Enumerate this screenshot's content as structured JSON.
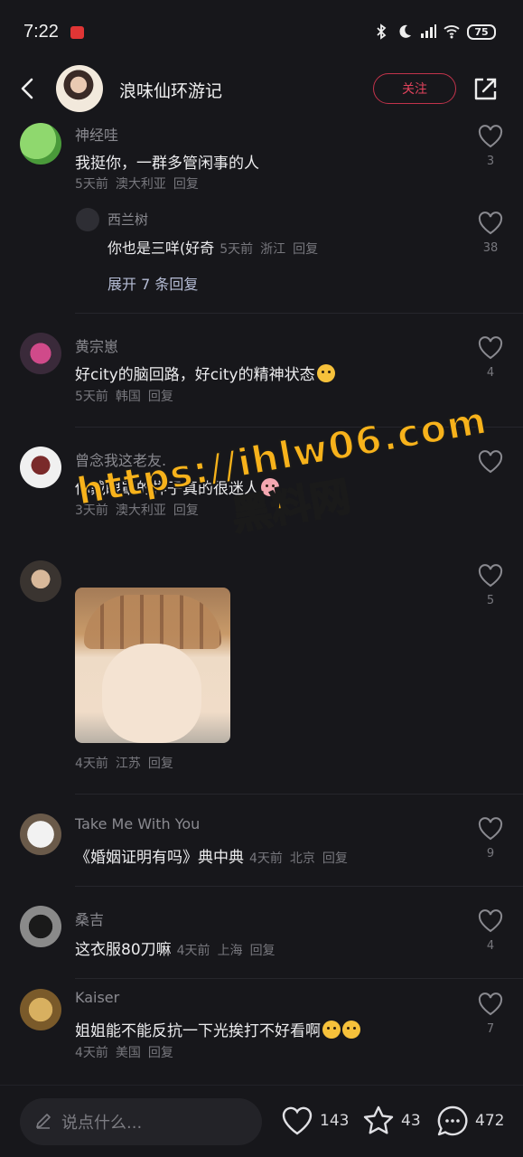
{
  "status": {
    "time": "7:22",
    "battery": "75"
  },
  "header": {
    "title": "浪味仙环游记",
    "follow_label": "关注"
  },
  "comments": [
    {
      "user": "神经哇",
      "text": "我挺你，一群多管闲事的人",
      "meta": [
        "5天前",
        "澳大利亚",
        "回复"
      ],
      "likes": "3",
      "reply": {
        "user": "西兰树",
        "text": "你也是三咩(好奇",
        "meta": [
          "5天前",
          "浙江",
          "回复"
        ],
        "likes": "38",
        "expand": "展开 7 条回复"
      }
    },
    {
      "user": "黄宗崽",
      "text": "好city的脑回路，好city的精神状态",
      "meta": [
        "5天前",
        "韩国",
        "回复"
      ],
      "likes": "4"
    },
    {
      "user": "曾念我这老友.",
      "text": "你戴眼罩的样子真的很迷人",
      "meta": [
        "3天前",
        "澳大利亚",
        "回复"
      ],
      "likes": ""
    },
    {
      "user": "",
      "text": "",
      "meta": [
        "4天前",
        "江苏",
        "回复"
      ],
      "likes": "5"
    },
    {
      "user": "Take Me With You",
      "text": "《婚姻证明有吗》典中典",
      "meta": [
        "4天前",
        "北京",
        "回复"
      ],
      "likes": "9"
    },
    {
      "user": "桑吉",
      "text": "这衣服80刀嘛",
      "meta": [
        "4天前",
        "上海",
        "回复"
      ],
      "likes": "4"
    },
    {
      "user": "Kaiser",
      "text": "姐姐能不能反抗一下光挨打不好看啊",
      "meta": [
        "4天前",
        "美国",
        "回复"
      ],
      "likes": "7"
    }
  ],
  "watermark": {
    "url": "https://ihlw06.com",
    "name": "黑料网"
  },
  "bottom": {
    "placeholder": "说点什么...",
    "likes": "143",
    "favorites": "43",
    "comments": "472"
  },
  "icons": [
    "back-icon",
    "share-icon",
    "heart-icon",
    "star-icon",
    "comment-icon",
    "pencil-icon",
    "bluetooth-icon",
    "moon-icon",
    "signal-icon",
    "wifi-icon"
  ],
  "colors": {
    "background": "#17171b",
    "follow": "#e2435c",
    "watermark": "#f7b21b"
  }
}
